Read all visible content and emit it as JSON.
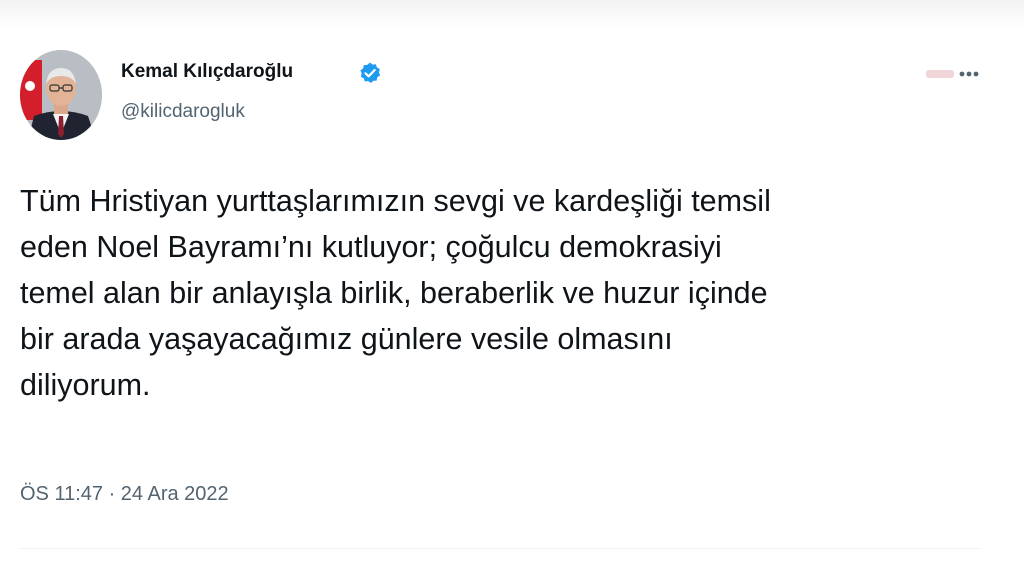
{
  "author": {
    "display_name": "Kemal Kılıçdaroğlu",
    "handle": "@kilicdarogluk",
    "verified": true,
    "verified_color": "#1d9bf0",
    "avatar_icon": "portrait-avatar"
  },
  "tweet": {
    "text_lines": [
      "Tüm Hristiyan yurttaşlarımızın sevgi ve kardeşliği temsil",
      "eden Noel Bayramı’nı kutluyor; çoğulcu demokrasiyi",
      "temel alan bir anlayışla birlik, beraberlik ve huzur içinde",
      "bir arada yaşayacağımız günlere vesile olmasını",
      "diliyorum."
    ],
    "timestamp": "ÖS 11:47 · 24 Ara 2022"
  },
  "icons": {
    "more": "more-options-icon",
    "verified": "verified-badge-icon"
  },
  "colors": {
    "text_primary": "#0f1419",
    "text_secondary": "#536471",
    "divider": "#eff3f4"
  }
}
